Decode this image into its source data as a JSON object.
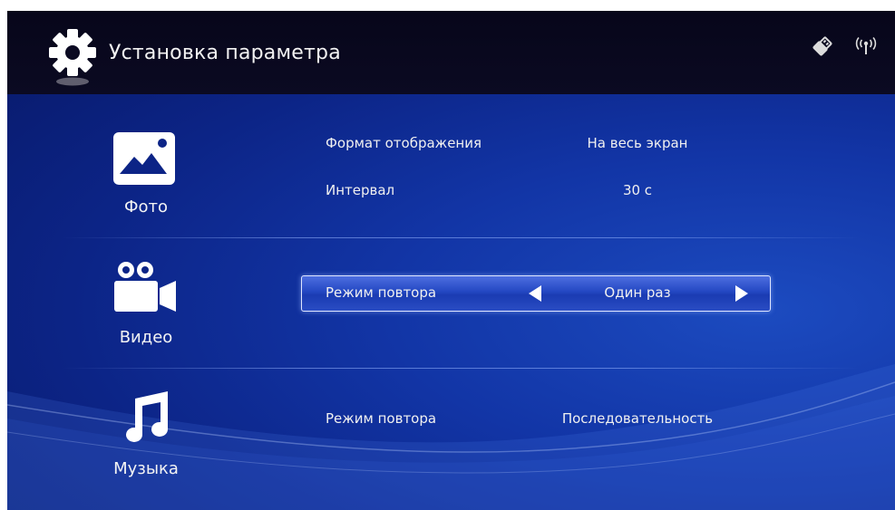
{
  "header": {
    "title": "Установка параметра",
    "icons": [
      "gear-icon",
      "usb-icon",
      "wifi-icon"
    ]
  },
  "categories": [
    {
      "label": "Фото",
      "icon": "photo-icon",
      "settings": [
        {
          "label": "Формат отображения",
          "value": "На весь экран"
        },
        {
          "label": "Интервал",
          "value": "30 с"
        }
      ]
    },
    {
      "label": "Видео",
      "icon": "video-camera-icon",
      "settings": [
        {
          "label": "Режим повтора",
          "value": "Один раз",
          "selected": true
        }
      ]
    },
    {
      "label": "Музыка",
      "icon": "music-note-icon",
      "settings": [
        {
          "label": "Режим повтора",
          "value": "Последовательность"
        }
      ]
    }
  ],
  "colors": {
    "background": "#1235a6",
    "topbar": "#0b0a22",
    "text": "#f0f0f0",
    "selection": "#2347c2"
  }
}
